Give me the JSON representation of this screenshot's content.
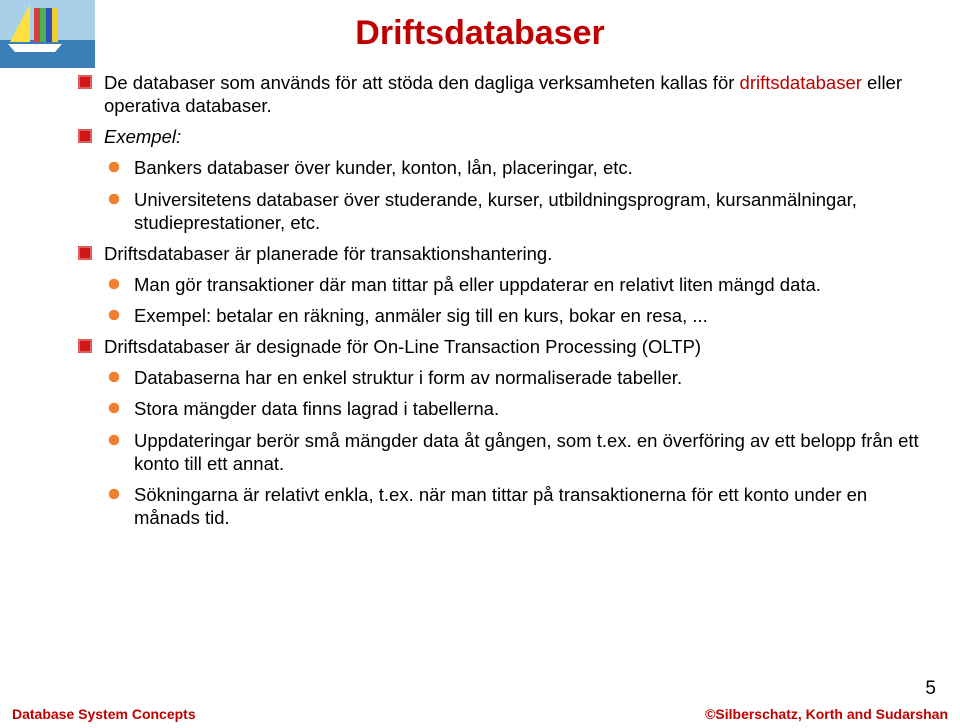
{
  "title": "Driftsdatabaser",
  "items": [
    {
      "level": 1,
      "pre": "De databaser som används för att stöda den dagliga verksamheten kallas för ",
      "hl": "driftsdatabaser",
      "post": " eller operativa databaser."
    },
    {
      "level": 1,
      "italic": true,
      "text": "Exempel:"
    },
    {
      "level": 2,
      "text": "Bankers databaser över kunder, konton, lån, placeringar, etc."
    },
    {
      "level": 2,
      "text": "Universitetens databaser över studerande, kurser, utbildningsprogram, kursanmälningar, studieprestationer, etc."
    },
    {
      "level": 1,
      "text": "Driftsdatabaser är planerade för transaktionshantering."
    },
    {
      "level": 2,
      "text": "Man gör transaktioner där man tittar på eller uppdaterar en relativt liten mängd data."
    },
    {
      "level": 2,
      "text": "Exempel: betalar en räkning, anmäler sig till en kurs, bokar en resa, ..."
    },
    {
      "level": 1,
      "text": "Driftsdatabaser är designade för On-Line Transaction Processing (OLTP)"
    },
    {
      "level": 2,
      "text": "Databaserna har en enkel struktur i form av normaliserade tabeller."
    },
    {
      "level": 2,
      "text": "Stora mängder data finns lagrad i tabellerna."
    },
    {
      "level": 2,
      "text": "Uppdateringar berör små mängder data åt gången, som t.ex. en överföring av ett belopp från ett konto till ett annat."
    },
    {
      "level": 2,
      "text": "Sökningarna är relativt enkla, t.ex. när man tittar på transaktionerna för ett konto under en månads tid."
    }
  ],
  "footer": {
    "left": "Database System Concepts",
    "right": "©Silberschatz, Korth and Sudarshan"
  },
  "page": "5"
}
